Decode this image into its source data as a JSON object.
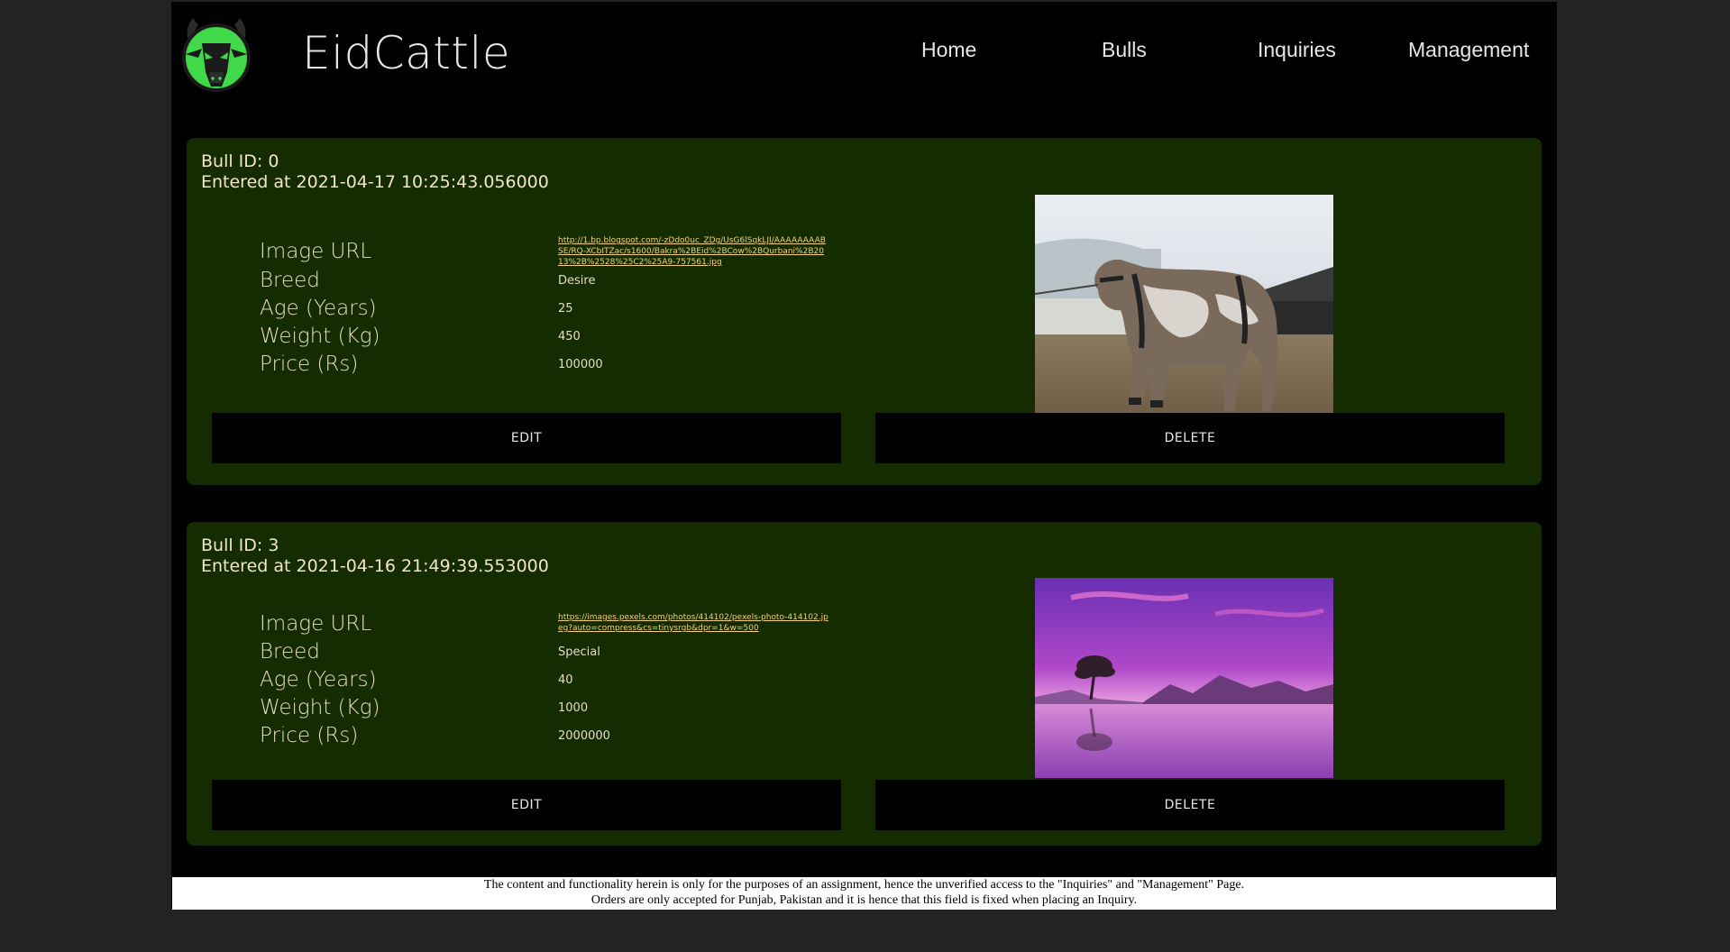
{
  "brand": {
    "name": "EidCattle"
  },
  "nav": [
    {
      "label": "Home"
    },
    {
      "label": "Bulls"
    },
    {
      "label": "Inquiries"
    },
    {
      "label": "Management"
    }
  ],
  "field_labels": {
    "image_url": "Image URL",
    "breed": "Breed",
    "age": "Age (Years)",
    "weight": "Weight (Kg)",
    "price": "Price (Rs)"
  },
  "bulls": [
    {
      "id_text": "Bull ID: 0",
      "entered_text": "Entered at 2021-04-17 10:25:43.056000",
      "image_url": "http://1.bp.blogspot.com/-zDdo0uc_ZDg/UsG6lSqkLJI/AAAAAAAABSE/RQ-XCbITZac/s1600/Bakra%2BEid%2BCow%2BQurbani%2B2013%2B%2528%25C2%25A9-757561.jpg",
      "breed": "Desire",
      "age": "25",
      "weight": "450",
      "price": "100000",
      "photo": "cow-photo",
      "edit_label": "EDIT",
      "delete_label": "DELETE"
    },
    {
      "id_text": "Bull ID: 3",
      "entered_text": "Entered at 2021-04-16 21:49:39.553000",
      "image_url": "https://images.pexels.com/photos/414102/pexels-photo-414102.jpeg?auto=compress&cs=tinysrgb&dpr=1&w=500",
      "breed": "Special",
      "age": "40",
      "weight": "1000",
      "price": "2000000",
      "photo": "lake-sunset-photo",
      "edit_label": "EDIT",
      "delete_label": "DELETE"
    }
  ],
  "footer": {
    "line1": "The content and functionality herein is only for the purposes of an assignment, hence the unverified access to the \"Inquiries\" and \"Management\" Page.",
    "line2": "Orders are only accepted for Punjab, Pakistan and it is hence that this field is fixed when placing an Inquiry."
  },
  "colors": {
    "page_bg": "#232323",
    "content_bg": "#000000",
    "card_bg": "#152b00",
    "logo_green": "#3fd94a",
    "link_yellow": "#f0d27a"
  }
}
